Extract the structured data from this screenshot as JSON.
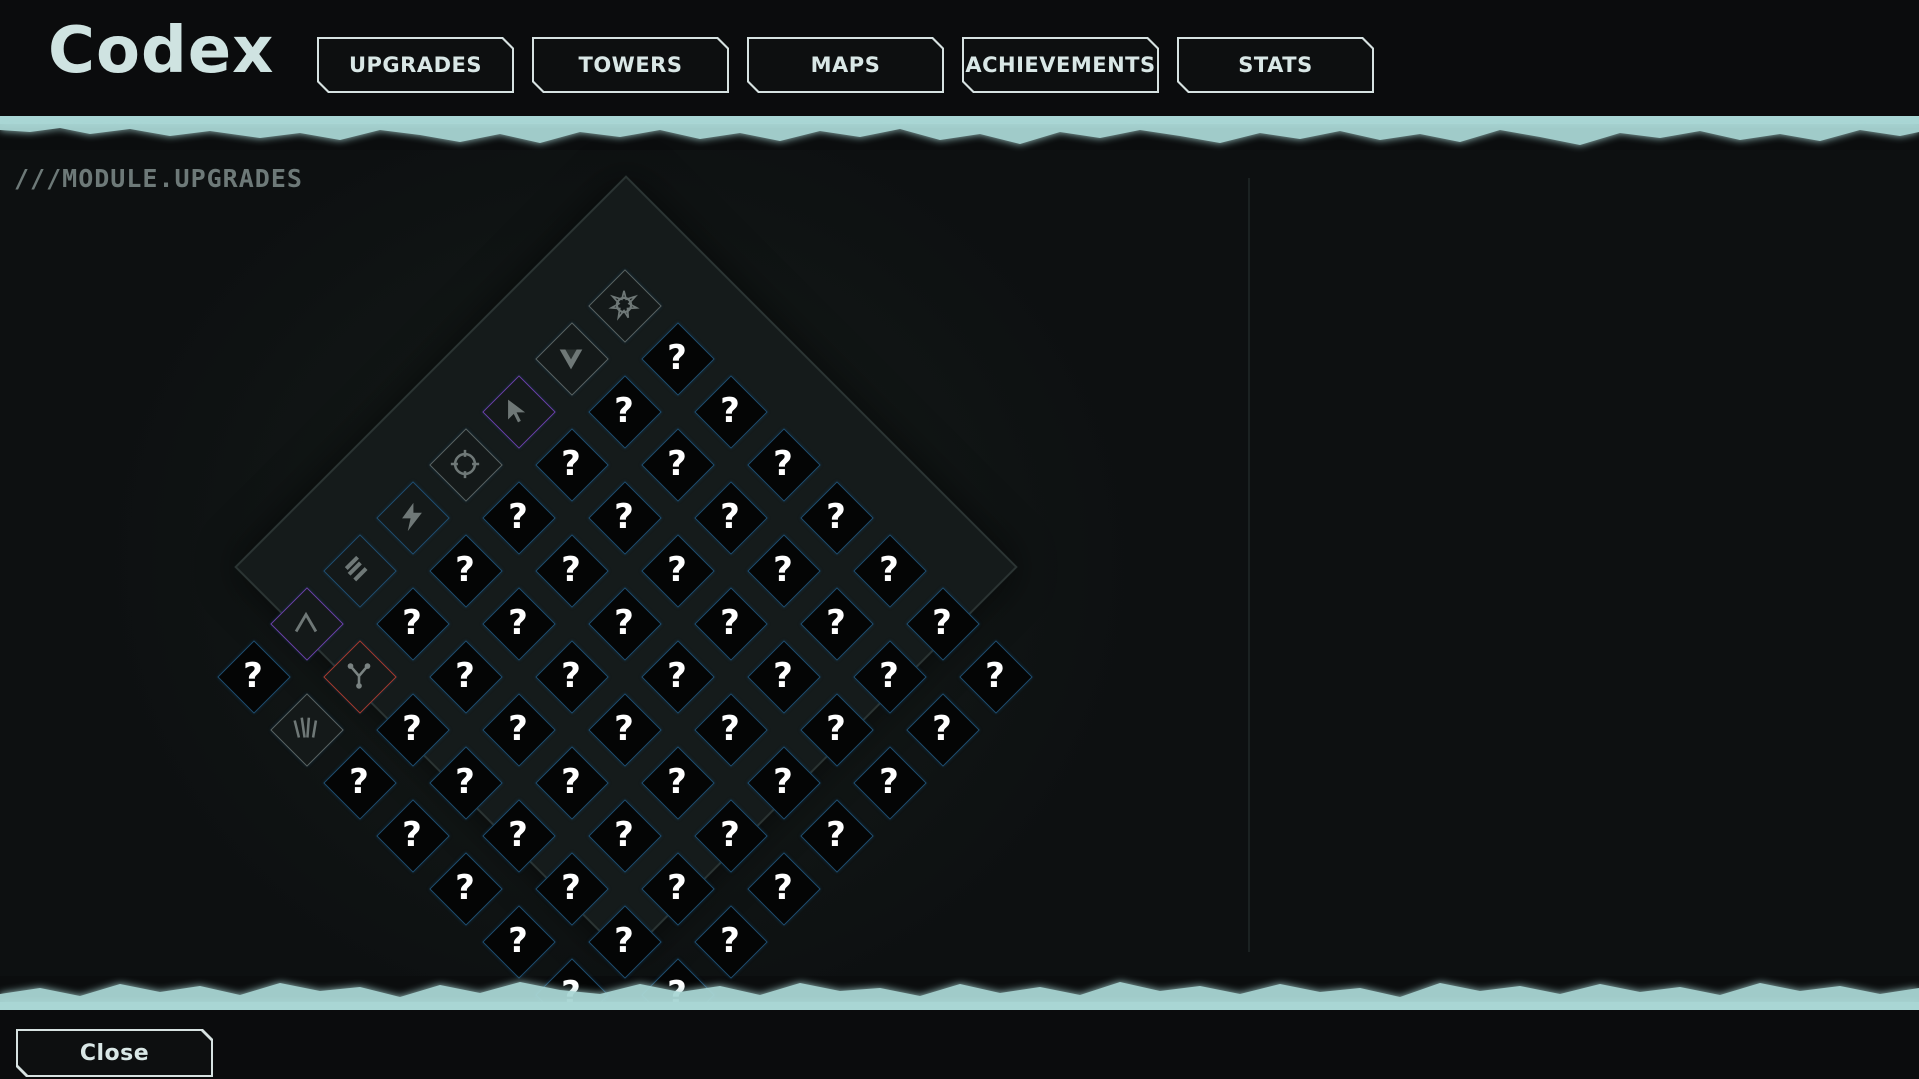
{
  "header": {
    "title": "Codex",
    "tabs": [
      {
        "label": "UPGRADES",
        "id": "upgrades"
      },
      {
        "label": "TOWERS",
        "id": "towers"
      },
      {
        "label": "MAPS",
        "id": "maps"
      },
      {
        "label": "ACHIEVEMENTS",
        "id": "achievements"
      },
      {
        "label": "STATS",
        "id": "stats"
      }
    ]
  },
  "module_label": "///MODULE.UPGRADES",
  "colors": {
    "accent_teal": "#a9d6d4",
    "cell_border": "#1f4e70",
    "background": "#0b0d0e"
  },
  "grid": {
    "locked_symbol": "?",
    "size": 8,
    "unlocked": [
      {
        "row": 0,
        "col": 0,
        "icon": "star-burst-icon",
        "accent": "#5a6362"
      },
      {
        "row": 1,
        "col": 0,
        "icon": "triangle-down-icon",
        "accent": "#5a6362"
      },
      {
        "row": 2,
        "col": 0,
        "icon": "cursor-arrow-icon",
        "accent": "#6a3fa8"
      },
      {
        "row": 3,
        "col": 0,
        "icon": "crosshair-ring-icon",
        "accent": "#5a6362"
      },
      {
        "row": 4,
        "col": 0,
        "icon": "lightning-icon",
        "accent": "#1f4e70"
      },
      {
        "row": 5,
        "col": 0,
        "icon": "triple-chevron-icon",
        "accent": "#1f4e70"
      },
      {
        "row": 6,
        "col": 0,
        "icon": "caret-up-icon",
        "accent": "#6a3fa8"
      },
      {
        "row": 6,
        "col": 1,
        "icon": "fork-branch-icon",
        "accent": "#a83a2f"
      },
      {
        "row": 7,
        "col": 1,
        "icon": "claw-marks-icon",
        "accent": "#5a6362"
      }
    ]
  },
  "footer": {
    "close_label": "Close"
  }
}
